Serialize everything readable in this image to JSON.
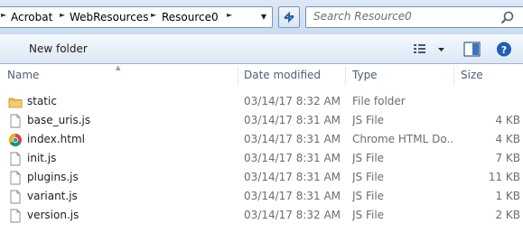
{
  "address": {
    "crumbs": [
      "Acrobat",
      "WebResources",
      "Resource0"
    ]
  },
  "search": {
    "placeholder": "Search Resource0"
  },
  "toolbar": {
    "new_folder_label": "New folder"
  },
  "columns": {
    "name": "Name",
    "date": "Date modified",
    "type": "Type",
    "size": "Size"
  },
  "files": [
    {
      "name": "static",
      "date": "03/14/17 8:32 AM",
      "type": "File folder",
      "size": "",
      "icon": "folder-icon"
    },
    {
      "name": "base_uris.js",
      "date": "03/14/17 8:31 AM",
      "type": "JS File",
      "size": "4 KB",
      "icon": "js-file-icon"
    },
    {
      "name": "index.html",
      "date": "03/14/17 8:31 AM",
      "type": "Chrome HTML Do...",
      "size": "4 KB",
      "icon": "chrome-icon"
    },
    {
      "name": "init.js",
      "date": "03/14/17 8:31 AM",
      "type": "JS File",
      "size": "7 KB",
      "icon": "js-file-icon"
    },
    {
      "name": "plugins.js",
      "date": "03/14/17 8:31 AM",
      "type": "JS File",
      "size": "11 KB",
      "icon": "js-file-icon"
    },
    {
      "name": "variant.js",
      "date": "03/14/17 8:31 AM",
      "type": "JS File",
      "size": "1 KB",
      "icon": "js-file-icon"
    },
    {
      "name": "version.js",
      "date": "03/14/17 8:32 AM",
      "type": "JS File",
      "size": "2 KB",
      "icon": "js-file-icon"
    }
  ],
  "colors": {
    "header_text": "#4c607a",
    "secondary_text": "#6d6d6d",
    "toolbar_bg": "#dce7f4",
    "folder": "#e8b84a"
  }
}
